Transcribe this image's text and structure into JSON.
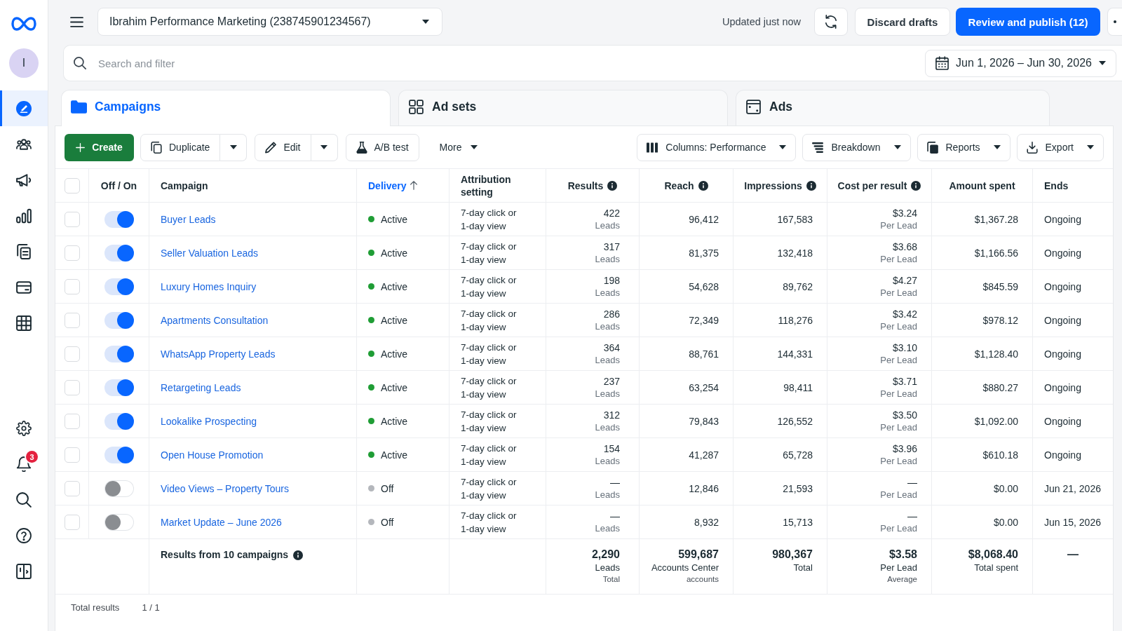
{
  "sidebar": {
    "avatar": "I",
    "top_items": [
      {
        "selected": true
      },
      {
        "selected": false
      },
      {
        "selected": false
      },
      {
        "selected": false
      },
      {
        "selected": false
      },
      {
        "selected": false
      },
      {
        "selected": false
      }
    ],
    "bottom_items": [
      {
        "selected": false
      },
      {
        "selected": false,
        "badge": "3"
      },
      {
        "selected": false
      },
      {
        "selected": false
      },
      {
        "selected": false
      }
    ]
  },
  "top_bar": {
    "account": "Ibrahim Performance Marketing (238745901234567)",
    "status": "Updated just now",
    "buttons": [
      {
        "label": "Discard drafts",
        "kind": "secondary"
      },
      {
        "label": "Review and publish (12)",
        "kind": "primary"
      }
    ]
  },
  "filter_bar": {
    "placeholder": "Search and filter",
    "date_range": "Jun 1, 2026 – Jun 30, 2026"
  },
  "tabs": [
    {
      "label": "Campaigns",
      "selected": true
    },
    {
      "label": "Ad sets",
      "selected": false
    },
    {
      "label": "Ads",
      "selected": false
    }
  ],
  "toolbar": {
    "left": [
      {
        "label": "Create",
        "kind": "primary"
      },
      {
        "label": "Duplicate",
        "kind": "split"
      },
      {
        "label": "Edit",
        "kind": "split"
      },
      {
        "label": "A/B test",
        "kind": "plain"
      },
      {
        "label": "More",
        "kind": "menu"
      }
    ],
    "right": [
      {
        "label": "Columns: Performance",
        "kind": "dropdown"
      },
      {
        "label": "Breakdown",
        "kind": "dropdown"
      },
      {
        "label": "Reports",
        "kind": "dropdown"
      },
      {
        "label": "Export",
        "kind": "dropdown"
      }
    ]
  },
  "table": {
    "select_all": {
      "checked": false
    },
    "columns": [
      {
        "label": "Off / On",
        "sorted": false,
        "info": false
      },
      {
        "label": "Campaign",
        "sorted": false,
        "info": false
      },
      {
        "label": "Delivery",
        "sorted": true,
        "info": false
      },
      {
        "label": "Attribution setting",
        "sorted": false,
        "info": false
      },
      {
        "label": "Results",
        "sorted": false,
        "info": true
      },
      {
        "label": "Reach",
        "sorted": false,
        "info": true
      },
      {
        "label": "Impressions",
        "sorted": false,
        "info": true
      },
      {
        "label": "Cost per result",
        "sorted": false,
        "info": true
      },
      {
        "label": "Amount spent",
        "sorted": false,
        "info": false
      },
      {
        "label": "Ends",
        "sorted": false,
        "info": false
      }
    ],
    "rows": [
      {
        "checked": false,
        "on": true,
        "name": "Buyer Leads",
        "delivery": {
          "label": "Active",
          "color": "#1f9d35"
        },
        "attribution": "7-day click or 1-day view",
        "results": {
          "value": "422",
          "unit": "Leads"
        },
        "reach": "96,412",
        "impressions": "167,583",
        "cost": {
          "value": "$3.24",
          "unit": "Per Lead"
        },
        "spent": "$1,367.28",
        "ends": "Ongoing"
      },
      {
        "checked": false,
        "on": true,
        "name": "Seller Valuation Leads",
        "delivery": {
          "label": "Active",
          "color": "#1f9d35"
        },
        "attribution": "7-day click or 1-day view",
        "results": {
          "value": "317",
          "unit": "Leads"
        },
        "reach": "81,375",
        "impressions": "132,418",
        "cost": {
          "value": "$3.68",
          "unit": "Per Lead"
        },
        "spent": "$1,166.56",
        "ends": "Ongoing"
      },
      {
        "checked": false,
        "on": true,
        "name": "Luxury Homes Inquiry",
        "delivery": {
          "label": "Active",
          "color": "#1f9d35"
        },
        "attribution": "7-day click or 1-day view",
        "results": {
          "value": "198",
          "unit": "Leads"
        },
        "reach": "54,628",
        "impressions": "89,762",
        "cost": {
          "value": "$4.27",
          "unit": "Per Lead"
        },
        "spent": "$845.59",
        "ends": "Ongoing"
      },
      {
        "checked": false,
        "on": true,
        "name": "Apartments Consultation",
        "delivery": {
          "label": "Active",
          "color": "#1f9d35"
        },
        "attribution": "7-day click or 1-day view",
        "results": {
          "value": "286",
          "unit": "Leads"
        },
        "reach": "72,349",
        "impressions": "118,276",
        "cost": {
          "value": "$3.42",
          "unit": "Per Lead"
        },
        "spent": "$978.12",
        "ends": "Ongoing"
      },
      {
        "checked": false,
        "on": true,
        "name": "WhatsApp Property Leads",
        "delivery": {
          "label": "Active",
          "color": "#1f9d35"
        },
        "attribution": "7-day click or 1-day view",
        "results": {
          "value": "364",
          "unit": "Leads"
        },
        "reach": "88,761",
        "impressions": "144,331",
        "cost": {
          "value": "$3.10",
          "unit": "Per Lead"
        },
        "spent": "$1,128.40",
        "ends": "Ongoing"
      },
      {
        "checked": false,
        "on": true,
        "name": "Retargeting Leads",
        "delivery": {
          "label": "Active",
          "color": "#1f9d35"
        },
        "attribution": "7-day click or 1-day view",
        "results": {
          "value": "237",
          "unit": "Leads"
        },
        "reach": "63,254",
        "impressions": "98,411",
        "cost": {
          "value": "$3.71",
          "unit": "Per Lead"
        },
        "spent": "$880.27",
        "ends": "Ongoing"
      },
      {
        "checked": false,
        "on": true,
        "name": "Lookalike Prospecting",
        "delivery": {
          "label": "Active",
          "color": "#1f9d35"
        },
        "attribution": "7-day click or 1-day view",
        "results": {
          "value": "312",
          "unit": "Leads"
        },
        "reach": "79,843",
        "impressions": "126,552",
        "cost": {
          "value": "$3.50",
          "unit": "Per Lead"
        },
        "spent": "$1,092.00",
        "ends": "Ongoing"
      },
      {
        "checked": false,
        "on": true,
        "name": "Open House Promotion",
        "delivery": {
          "label": "Active",
          "color": "#1f9d35"
        },
        "attribution": "7-day click or 1-day view",
        "results": {
          "value": "154",
          "unit": "Leads"
        },
        "reach": "41,287",
        "impressions": "65,728",
        "cost": {
          "value": "$3.96",
          "unit": "Per Lead"
        },
        "spent": "$610.18",
        "ends": "Ongoing"
      },
      {
        "checked": false,
        "on": false,
        "name": "Video Views – Property Tours",
        "delivery": {
          "label": "Off",
          "color": "#b4b7bc"
        },
        "attribution": "7-day click or 1-day view",
        "results": {
          "value": "—",
          "unit": "Leads"
        },
        "reach": "12,846",
        "impressions": "21,593",
        "cost": {
          "value": "—",
          "unit": "Per Lead"
        },
        "spent": "$0.00",
        "ends": "Jun 21, 2026"
      },
      {
        "checked": false,
        "on": false,
        "name": "Market Update – June 2026",
        "delivery": {
          "label": "Off",
          "color": "#b4b7bc"
        },
        "attribution": "7-day click or 1-day view",
        "results": {
          "value": "—",
          "unit": "Leads"
        },
        "reach": "8,932",
        "impressions": "15,713",
        "cost": {
          "value": "—",
          "unit": "Per Lead"
        },
        "spent": "$0.00",
        "ends": "Jun 15, 2026"
      }
    ],
    "summary": {
      "label": "Results from 10 campaigns",
      "info": true,
      "cells": [
        {
          "value": "2,290",
          "label": "Leads",
          "note": "Total"
        },
        {
          "value": "599,687",
          "label": "Accounts Center",
          "note": "accounts"
        },
        {
          "value": "980,367",
          "label": "Total"
        },
        {
          "value": "$3.58",
          "label": "Per Lead",
          "note": "Average"
        },
        {
          "value": "$8,068.40",
          "label": "Total spent"
        },
        {
          "value": "—"
        }
      ]
    }
  },
  "footer": {
    "label": "Total results",
    "value": "1 / 1"
  }
}
